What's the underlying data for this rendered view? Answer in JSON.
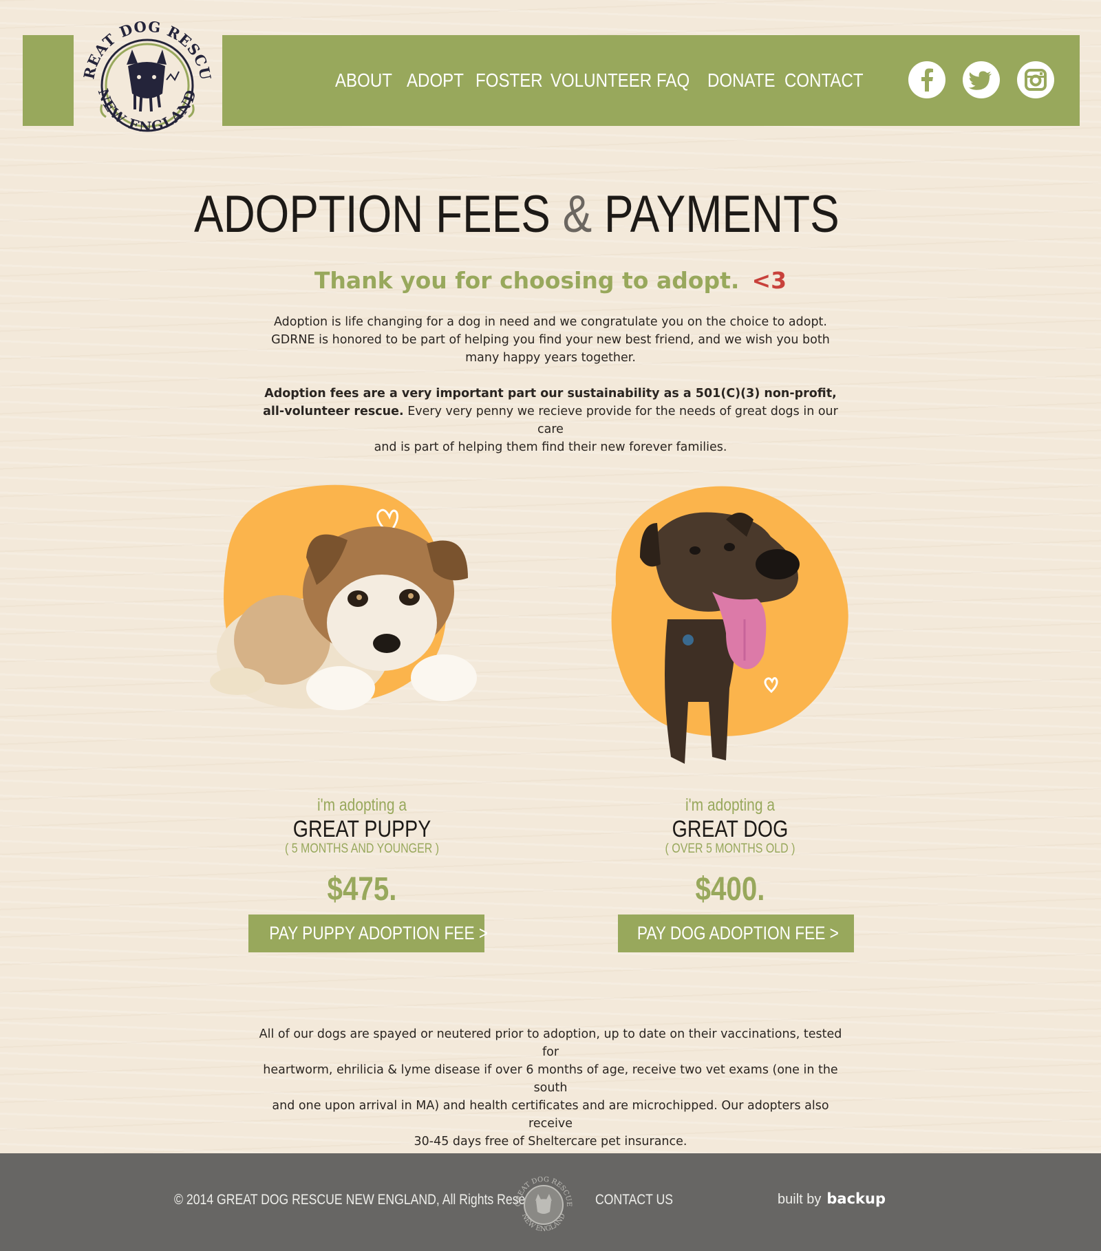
{
  "header": {
    "logo": {
      "top_text": "GREAT DOG RESCUE",
      "bottom_text": "NEW ENGLAND"
    },
    "nav": [
      {
        "label": "ABOUT"
      },
      {
        "label": "ADOPT"
      },
      {
        "label": "FOSTER"
      },
      {
        "label": "VOLUNTEER"
      },
      {
        "label": "FAQ"
      },
      {
        "label": "DONATE"
      },
      {
        "label": "CONTACT"
      }
    ],
    "social": [
      {
        "icon": "facebook-icon"
      },
      {
        "icon": "twitter-icon"
      },
      {
        "icon": "instagram-icon"
      }
    ]
  },
  "main": {
    "title_part1": "ADOPTION FEES ",
    "title_amp": "&",
    "title_part2": " PAYMENTS",
    "thanks": "Thank you for choosing to adopt.",
    "thanks_heart": "<3",
    "intro_line1": "Adoption is life changing for a dog in need and we congratulate you on the choice to adopt.",
    "intro_line2": "GDRNE is honored to be part of helping you find your new best friend, and we wish you both",
    "intro_line3": "many happy years together.",
    "fees_bold_1": "Adoption fees are a very important part our sustainability as a 501(C)(3) non-profit,",
    "fees_bold_2": "all-volunteer rescue.",
    "fees_rest_2": " Every very penny we recieve provide for the needs of great dogs in our care",
    "fees_line3": "and is part of helping them find their new forever families.",
    "cards": [
      {
        "adopting": "i'm adopting a",
        "kind": "GREAT PUPPY",
        "age": "( 5 MONTHS AND YOUNGER )",
        "price": "$475.",
        "button": "PAY PUPPY ADOPTION FEE >"
      },
      {
        "adopting": "i'm adopting a",
        "kind": "GREAT DOG",
        "age": "( OVER 5 MONTHS OLD )",
        "price": "$400.",
        "button": "PAY DOG ADOPTION FEE >"
      }
    ],
    "bottom_line1": "All of our dogs are spayed or neutered prior to adoption, up to date on their vaccinations, tested for",
    "bottom_line2": "heartworm, ehrilicia & lyme disease if over 6 months of age, receive two vet exams (one in the south",
    "bottom_line3": "and one upon arrival in MA) and health certificates and are microchipped. Our adopters also receive",
    "bottom_line4": "30-45 days free of Sheltercare pet insurance."
  },
  "footer": {
    "copyright": "© 2014 GREAT DOG RESCUE NEW ENGLAND, All Rights Reserved",
    "logo_top": "GREAT DOG RESCUE",
    "logo_bottom": "NEW ENGLAND",
    "contact": "CONTACT US",
    "built_by": "built  by",
    "builder": "backup"
  },
  "colors": {
    "accent_green": "#98a85c",
    "orange_blob": "#fbb44c",
    "heart_red": "#c8413b",
    "footer_gray": "#676664",
    "background": "#f3e9da"
  }
}
